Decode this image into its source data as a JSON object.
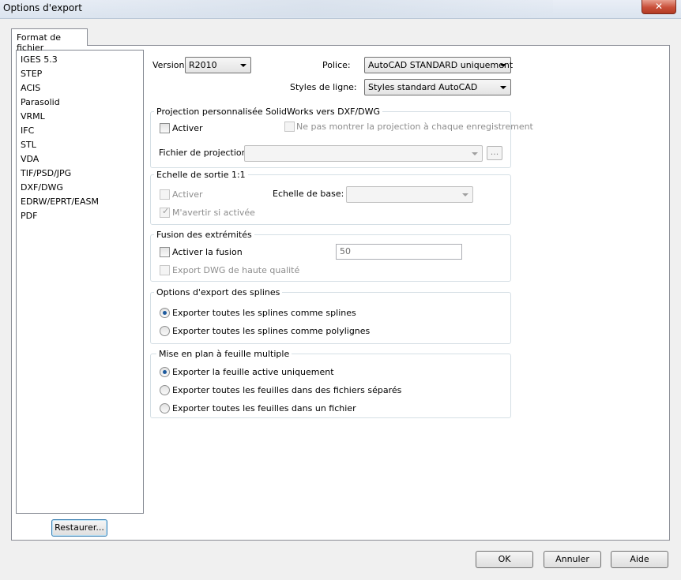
{
  "window": {
    "title": "Options d'export",
    "close_glyph": "✕"
  },
  "tab": {
    "label": "Format de fichier"
  },
  "formats": [
    "IGES 5.3",
    "STEP",
    "ACIS",
    "Parasolid",
    "VRML",
    "IFC",
    "STL",
    "VDA",
    "TIF/PSD/JPG",
    "DXF/DWG",
    "EDRW/EPRT/EASM",
    "PDF"
  ],
  "top": {
    "version_label": "Version:",
    "version_value": "R2010",
    "police_label": "Police:",
    "police_value": "AutoCAD STANDARD uniquement",
    "styles_label": "Styles de ligne:",
    "styles_value": "Styles standard AutoCAD"
  },
  "projection": {
    "title": "Projection personnalisée SolidWorks vers DXF/DWG",
    "activer": "Activer",
    "ne_pas": "Ne pas montrer la projection à chaque enregistrement",
    "fichier_label": "Fichier de projection:",
    "fichier_value": "",
    "browse": "..."
  },
  "echelle": {
    "title": "Echelle de sortie 1:1",
    "activer": "Activer",
    "base_label": "Echelle de base:",
    "base_value": "",
    "avertir": "M'avertir si activée",
    "check_glyph": "✓"
  },
  "fusion": {
    "title": "Fusion des extrémités",
    "activer": "Activer la fusion",
    "value": "50",
    "hq": "Export DWG de haute qualité"
  },
  "splines": {
    "title": "Options d'export des splines",
    "opt1": "Exporter toutes les splines comme splines",
    "opt2": "Exporter toutes les splines comme polylignes"
  },
  "sheets": {
    "title": "Mise en plan à feuille multiple",
    "opt1": "Exporter la feuille active uniquement",
    "opt2": "Exporter toutes les feuilles dans des fichiers séparés",
    "opt3": "Exporter toutes les feuilles dans un fichier"
  },
  "buttons": {
    "restore": "Restaurer...",
    "ok": "OK",
    "cancel": "Annuler",
    "help": "Aide"
  }
}
